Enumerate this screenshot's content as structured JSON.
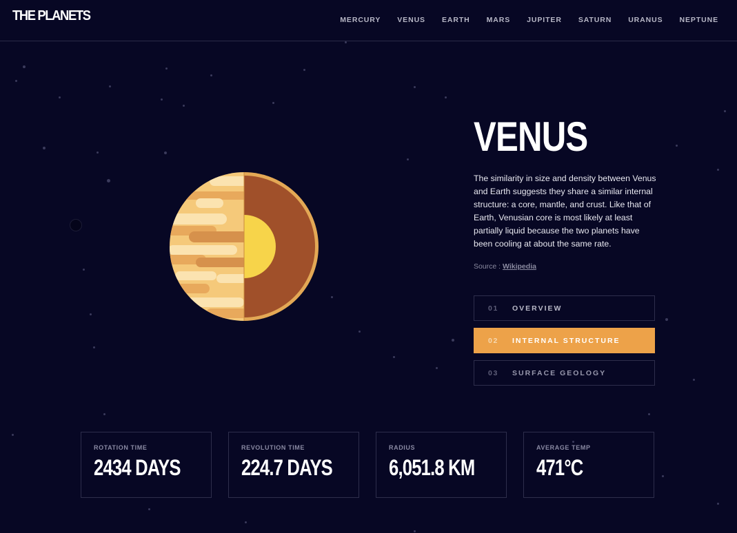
{
  "header": {
    "logo": "THE PLANETS",
    "nav": [
      "MERCURY",
      "VENUS",
      "EARTH",
      "MARS",
      "JUPITER",
      "SATURN",
      "URANUS",
      "NEPTUNE"
    ]
  },
  "planet": {
    "name": "VENUS",
    "description": "The similarity in size and density between Venus and Earth suggests they share a similar internal structure: a core, mantle, and crust. Like that of Earth, Venusian core is most likely at least partially liquid because the two planets have been cooling at about the same rate.",
    "source_prefix": "Source : ",
    "source_link": "Wikipedia",
    "image": "venus-internal-structure-icon"
  },
  "tabs": [
    {
      "num": "01",
      "label": "OVERVIEW",
      "active": false
    },
    {
      "num": "02",
      "label": "INTERNAL STRUCTURE",
      "active": true
    },
    {
      "num": "03",
      "label": "SURFACE GEOLOGY",
      "active": false
    }
  ],
  "stats": [
    {
      "label": "ROTATION TIME",
      "value": "2434 DAYS"
    },
    {
      "label": "REVOLUTION TIME",
      "value": "224.7 DAYS"
    },
    {
      "label": "RADIUS",
      "value": "6,051.8 KM"
    },
    {
      "label": "AVERAGE TEMP",
      "value": "471°C"
    }
  ],
  "colors": {
    "background": "#070724",
    "accent": "#EDA249",
    "border": "#2E2E4C"
  }
}
